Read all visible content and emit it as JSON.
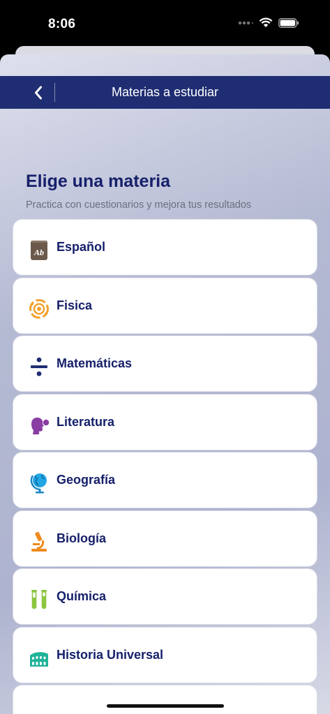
{
  "status_bar": {
    "time": "8:06"
  },
  "navbar": {
    "title": "Materias a estudiar",
    "back_icon": "chevron-left-icon"
  },
  "header": {
    "title": "Elige una materia",
    "subtitle": "Practica con cuestionarios y mejora tus resultados"
  },
  "subjects": [
    {
      "label": "Español",
      "icon": "book-icon"
    },
    {
      "label": "Fisica",
      "icon": "atom-icon"
    },
    {
      "label": "Matemáticas",
      "icon": "divide-icon"
    },
    {
      "label": "Literatura",
      "icon": "speaking-head-icon"
    },
    {
      "label": "Geografía",
      "icon": "globe-icon"
    },
    {
      "label": "Biología",
      "icon": "microscope-icon"
    },
    {
      "label": "Química",
      "icon": "test-tubes-icon"
    },
    {
      "label": "Historia Universal",
      "icon": "colosseum-icon"
    }
  ],
  "colors": {
    "navbar": "#1f2e72",
    "text_primary": "#16206a",
    "text_secondary": "#6b6f80"
  }
}
